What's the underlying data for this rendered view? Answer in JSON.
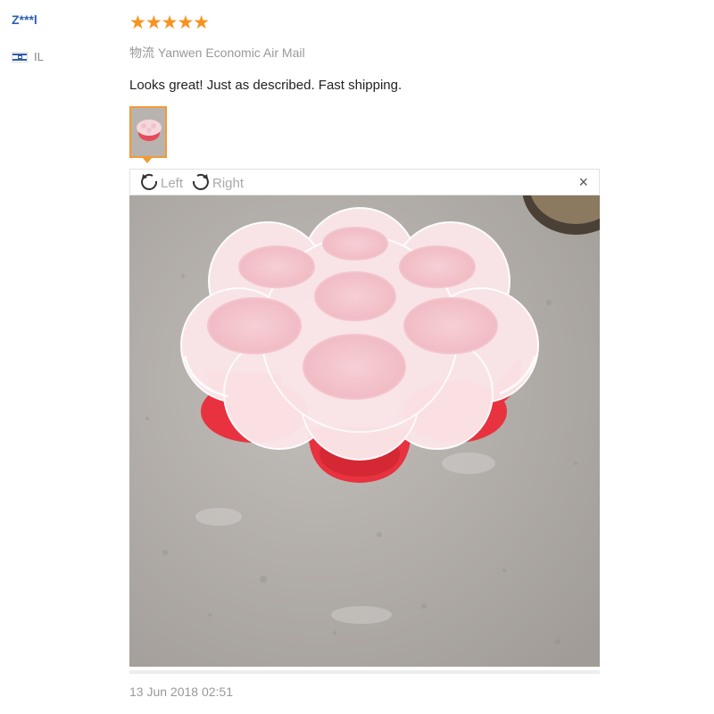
{
  "reviewer": {
    "name": "Z***l",
    "country_code": "IL",
    "flag_icon": "israel-flag-icon"
  },
  "review": {
    "rating": 5,
    "stars_text": "★★★★★",
    "logistics": "物流 Yanwen Economic Air Mail",
    "feedback": "Looks great! Just as described. Fast shipping.",
    "date": "13 Jun 2018 02:51"
  },
  "viewer": {
    "rotate_left_label": "Left",
    "rotate_right_label": "Right",
    "close_symbol": "×"
  },
  "colors": {
    "star": "#f7931e",
    "thumb_selected_border": "#f29a35",
    "name": "#2a5fb0"
  }
}
